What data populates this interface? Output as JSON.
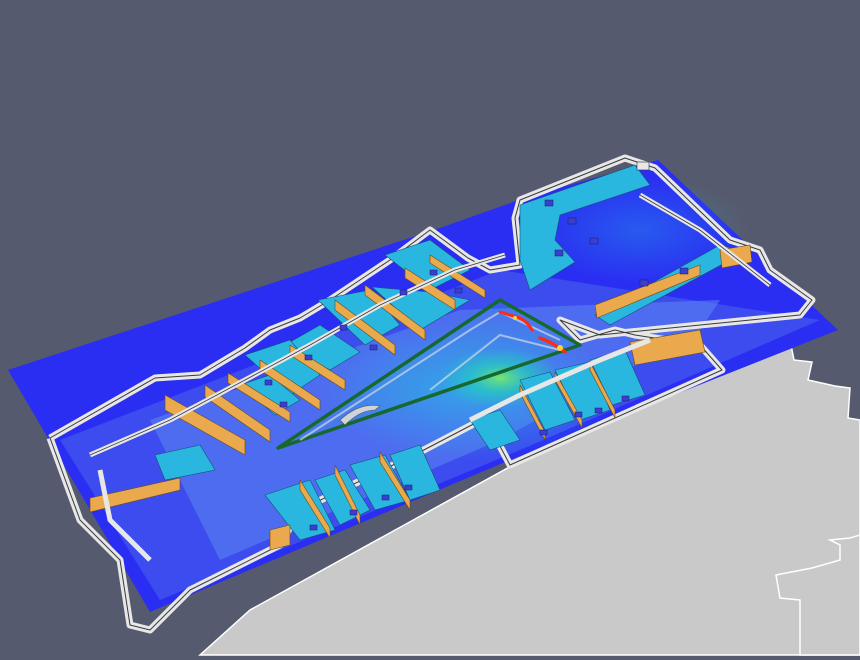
{
  "scene": {
    "kind": "3d-building-floorplan-heatmap",
    "colors": {
      "background": "#565a6e",
      "ground": "#c9c9c9",
      "ground_edge": "#ffffff",
      "heat_low": "#2a2df2",
      "heat_mid_low": "#4f7af0",
      "heat_mid": "#1fc8e6",
      "heat_high": "#39d97e",
      "heat_peak": "#ff2a12",
      "room_floor": "#2ab7df",
      "wall_top": "#e7e7e7",
      "wall_side": "#c8c8c8",
      "wall_edge": "#3a3a3a",
      "interior_wall": "#e9a94c",
      "highlight_zone": "#17682f",
      "vent": "#3a3fcf"
    }
  }
}
